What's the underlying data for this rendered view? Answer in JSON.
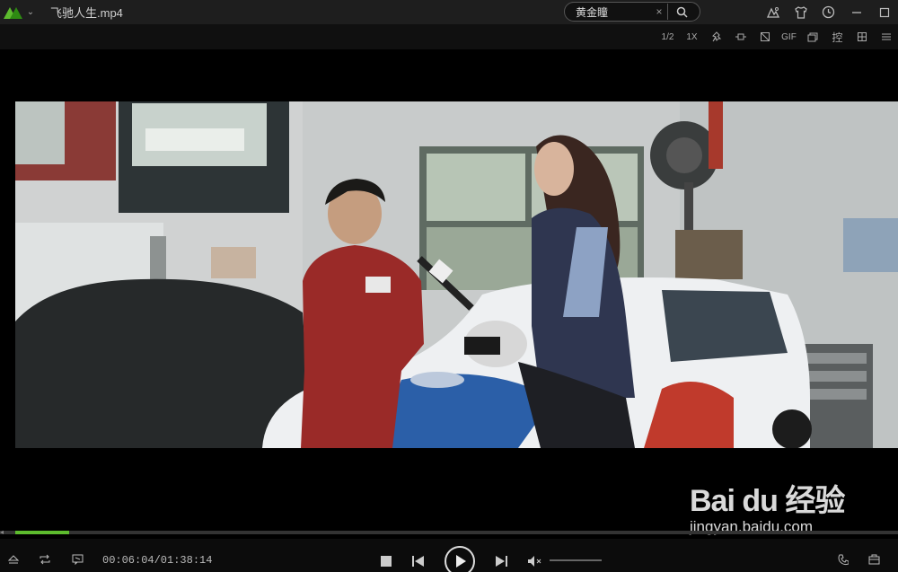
{
  "titlebar": {
    "file_name": "飞驰人生.mp4",
    "search_value": "黄金瞳",
    "clear_label": "×"
  },
  "toolbar": {
    "half_speed": "1/2",
    "normal_speed": "1X",
    "gif": "GIF",
    "control": "控"
  },
  "player": {
    "time": "00:06:04/01:38:14",
    "progress": 0.06
  },
  "watermark": {
    "brand": "Bai du 经验",
    "url": "jingyan.baidu.com"
  },
  "colors": {
    "accent": "#5dbb2e",
    "titlebar": "#1e1e1e"
  }
}
